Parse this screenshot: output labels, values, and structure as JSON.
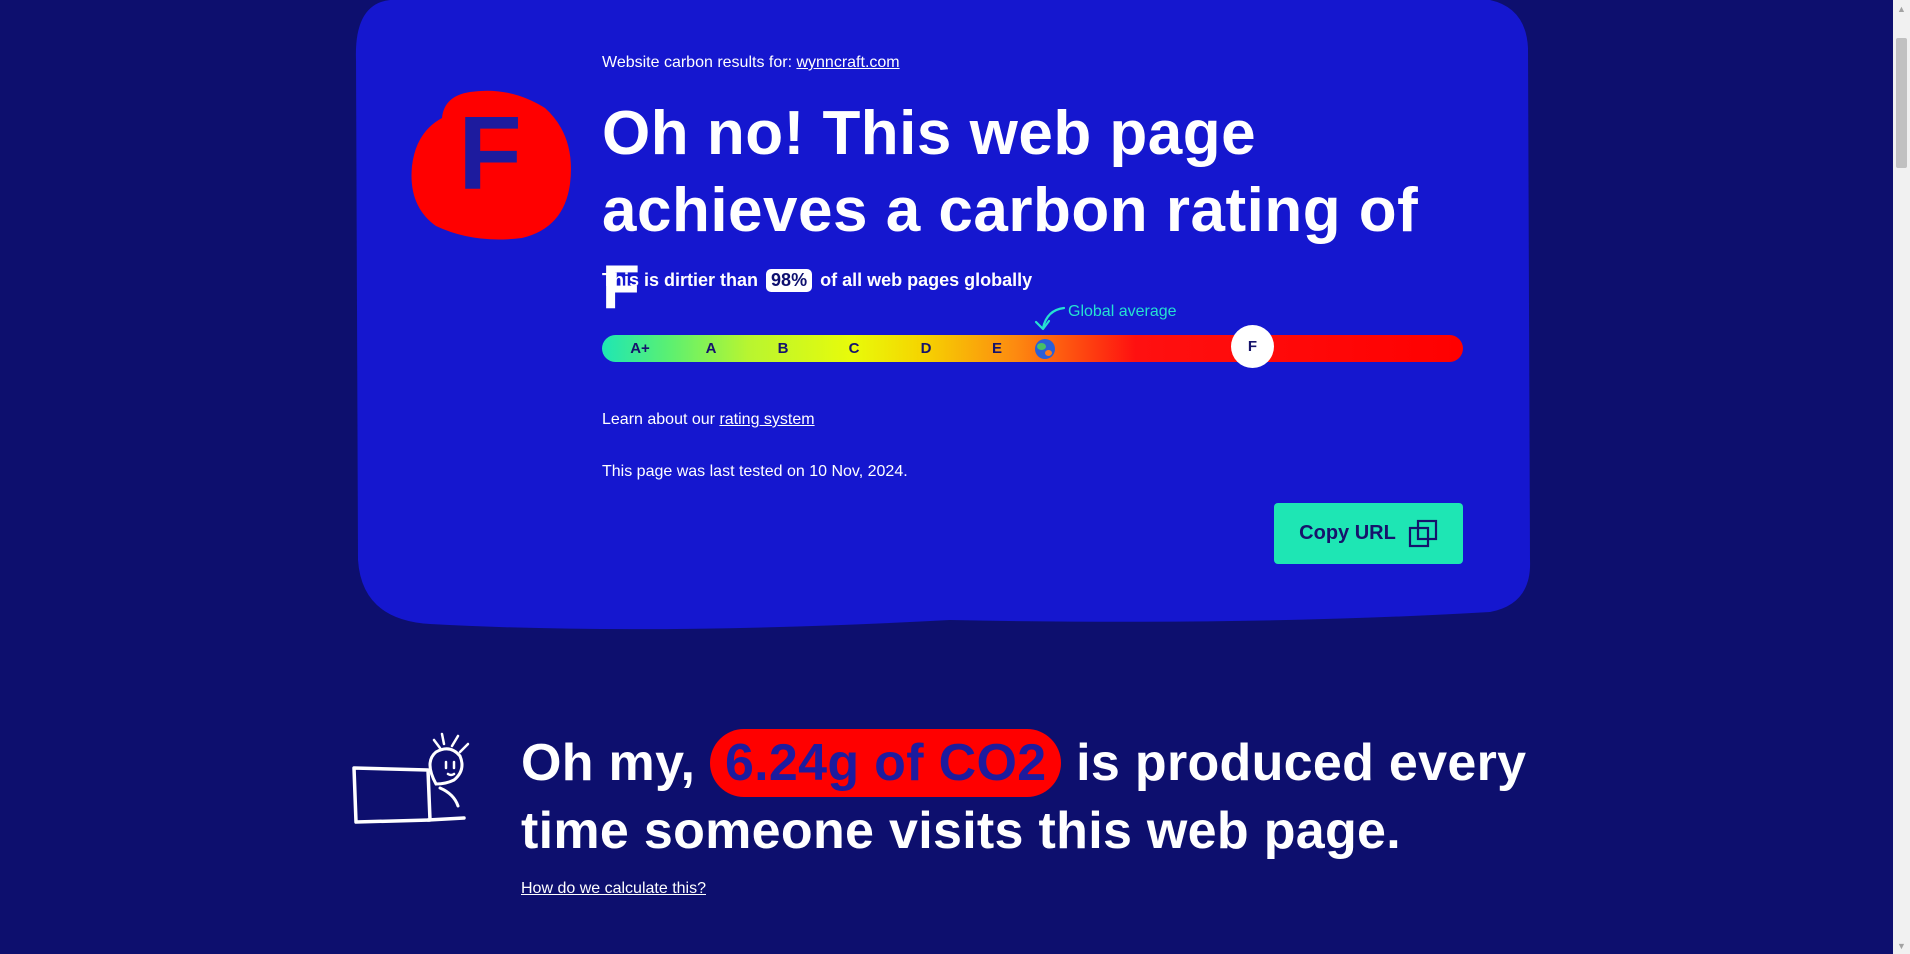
{
  "result": {
    "prefix": "Website carbon results for:",
    "domain": "wynncraft.com",
    "grade": "F",
    "headline": "Oh no! This web page achieves a carbon rating of F",
    "dirtier_prefix": "This is dirtier than",
    "dirtier_percent": "98%",
    "dirtier_suffix": "of all web pages globally"
  },
  "rating_bar": {
    "labels": [
      "A+",
      "A",
      "B",
      "C",
      "D",
      "E"
    ],
    "global_average_label": "Global average",
    "marker_label": "F"
  },
  "learn": {
    "text": "Learn about our",
    "link": "rating system"
  },
  "tested_text": "This page was last tested on 10 Nov, 2024.",
  "copy_button": {
    "label": "Copy URL",
    "icon": "copy-icon"
  },
  "emissions": {
    "prefix": "Oh my,",
    "amount": "6.24g of CO2",
    "suffix": "is produced every time someone visits this web page.",
    "link": "How do we calculate this?"
  },
  "colors": {
    "background": "#0d0f6e",
    "card": "#1517cf",
    "grade_red": "#ff0000",
    "accent": "#1ee6b4"
  }
}
